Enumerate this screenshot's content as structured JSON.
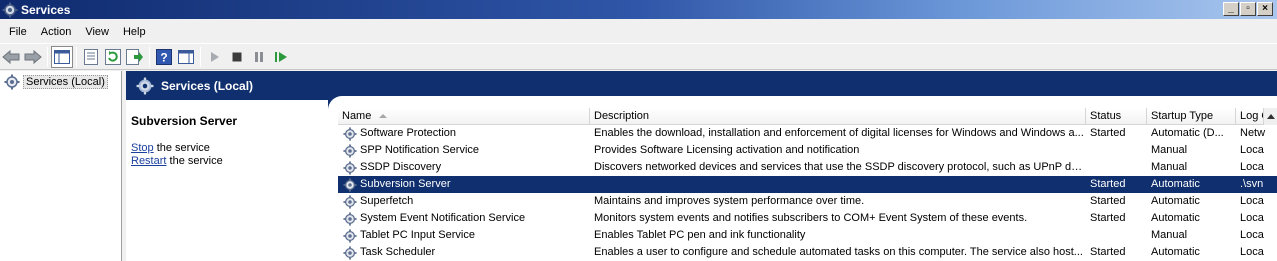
{
  "window": {
    "title": "Services"
  },
  "menu": [
    "File",
    "Action",
    "View",
    "Help"
  ],
  "toolbar": {
    "icons": [
      "back-arrow-icon",
      "forward-arrow-icon",
      "show-hide-console-tree-icon",
      "properties-icon",
      "refresh-icon",
      "export-list-icon",
      "help-icon",
      "show-hide-action-pane-icon",
      "start-service-icon",
      "stop-service-icon",
      "pause-service-icon",
      "restart-service-icon"
    ]
  },
  "tree": {
    "root_label": "Services (Local)"
  },
  "header": {
    "title": "Services (Local)"
  },
  "details": {
    "service_name": "Subversion Server",
    "stop_link": "Stop",
    "stop_rest": " the service",
    "restart_link": "Restart",
    "restart_rest": " the service"
  },
  "list": {
    "columns": [
      "Name",
      "Description",
      "Status",
      "Startup Type",
      "Log O"
    ],
    "rows": [
      {
        "name": "Software Protection",
        "description": "Enables the download, installation and enforcement of digital licenses for Windows and Windows a...",
        "status": "Started",
        "startup": "Automatic (D...",
        "logon": "Netw"
      },
      {
        "name": "SPP Notification Service",
        "description": "Provides Software Licensing activation and notification",
        "status": "",
        "startup": "Manual",
        "logon": "Loca"
      },
      {
        "name": "SSDP Discovery",
        "description": "Discovers networked devices and services that use the SSDP discovery protocol, such as UPnP de...",
        "status": "",
        "startup": "Manual",
        "logon": "Loca"
      },
      {
        "name": "Subversion Server",
        "description": "",
        "status": "Started",
        "startup": "Automatic",
        "logon": ".\\svn"
      },
      {
        "name": "Superfetch",
        "description": "Maintains and improves system performance over time.",
        "status": "Started",
        "startup": "Automatic",
        "logon": "Loca"
      },
      {
        "name": "System Event Notification Service",
        "description": "Monitors system events and notifies subscribers to COM+ Event System of these events.",
        "status": "Started",
        "startup": "Automatic",
        "logon": "Loca"
      },
      {
        "name": "Tablet PC Input Service",
        "description": "Enables Tablet PC pen and ink functionality",
        "status": "",
        "startup": "Manual",
        "logon": "Loca"
      },
      {
        "name": "Task Scheduler",
        "description": "Enables a user to configure and schedule automated tasks on this computer. The service also host...",
        "status": "Started",
        "startup": "Automatic",
        "logon": "Loca"
      }
    ],
    "selected_index": 3
  },
  "colors": {
    "selection": "#102f6e",
    "header_band": "#102f6e",
    "link": "#1a3f9c"
  }
}
